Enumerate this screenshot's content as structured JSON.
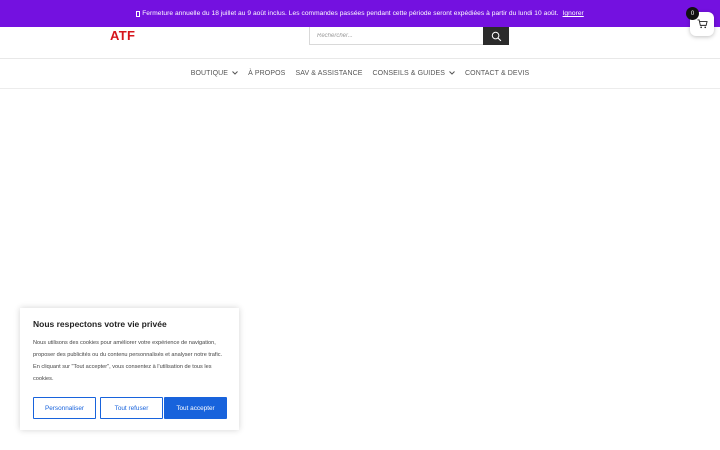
{
  "notice_bar": {
    "text": "Fermeture annuelle du 18 juillet au 9 août inclus. Les commandes passées pendant cette période seront expédiées à partir du lundi 10 août.",
    "dismiss_label": "Ignorer",
    "background": "#7411e0"
  },
  "header": {
    "logo_text": "ATF",
    "search": {
      "placeholder": "Rechercher..."
    },
    "cart": {
      "count": "0"
    }
  },
  "nav": {
    "items": [
      {
        "label": "BOUTIQUE",
        "has_dropdown": true
      },
      {
        "label": "À PROPOS",
        "has_dropdown": false
      },
      {
        "label": "SAV & ASSISTANCE",
        "has_dropdown": false
      },
      {
        "label": "CONSEILS & GUIDES",
        "has_dropdown": true
      },
      {
        "label": "CONTACT & DEVIS",
        "has_dropdown": false
      }
    ]
  },
  "cookie_banner": {
    "title": "Nous respectons votre vie privée",
    "text": "Nous utilisons des cookies pour améliorer votre expérience de navigation, proposer des publicités ou du contenu personnalisés et analyser notre trafic. En cliquant sur \"Tout accepter\", vous consentez à l'utilisation de tous les cookies.",
    "buttons": {
      "customize": "Personnaliser",
      "reject": "Tout refuser",
      "accept": "Tout accepter"
    },
    "accent": "#1863dc"
  }
}
